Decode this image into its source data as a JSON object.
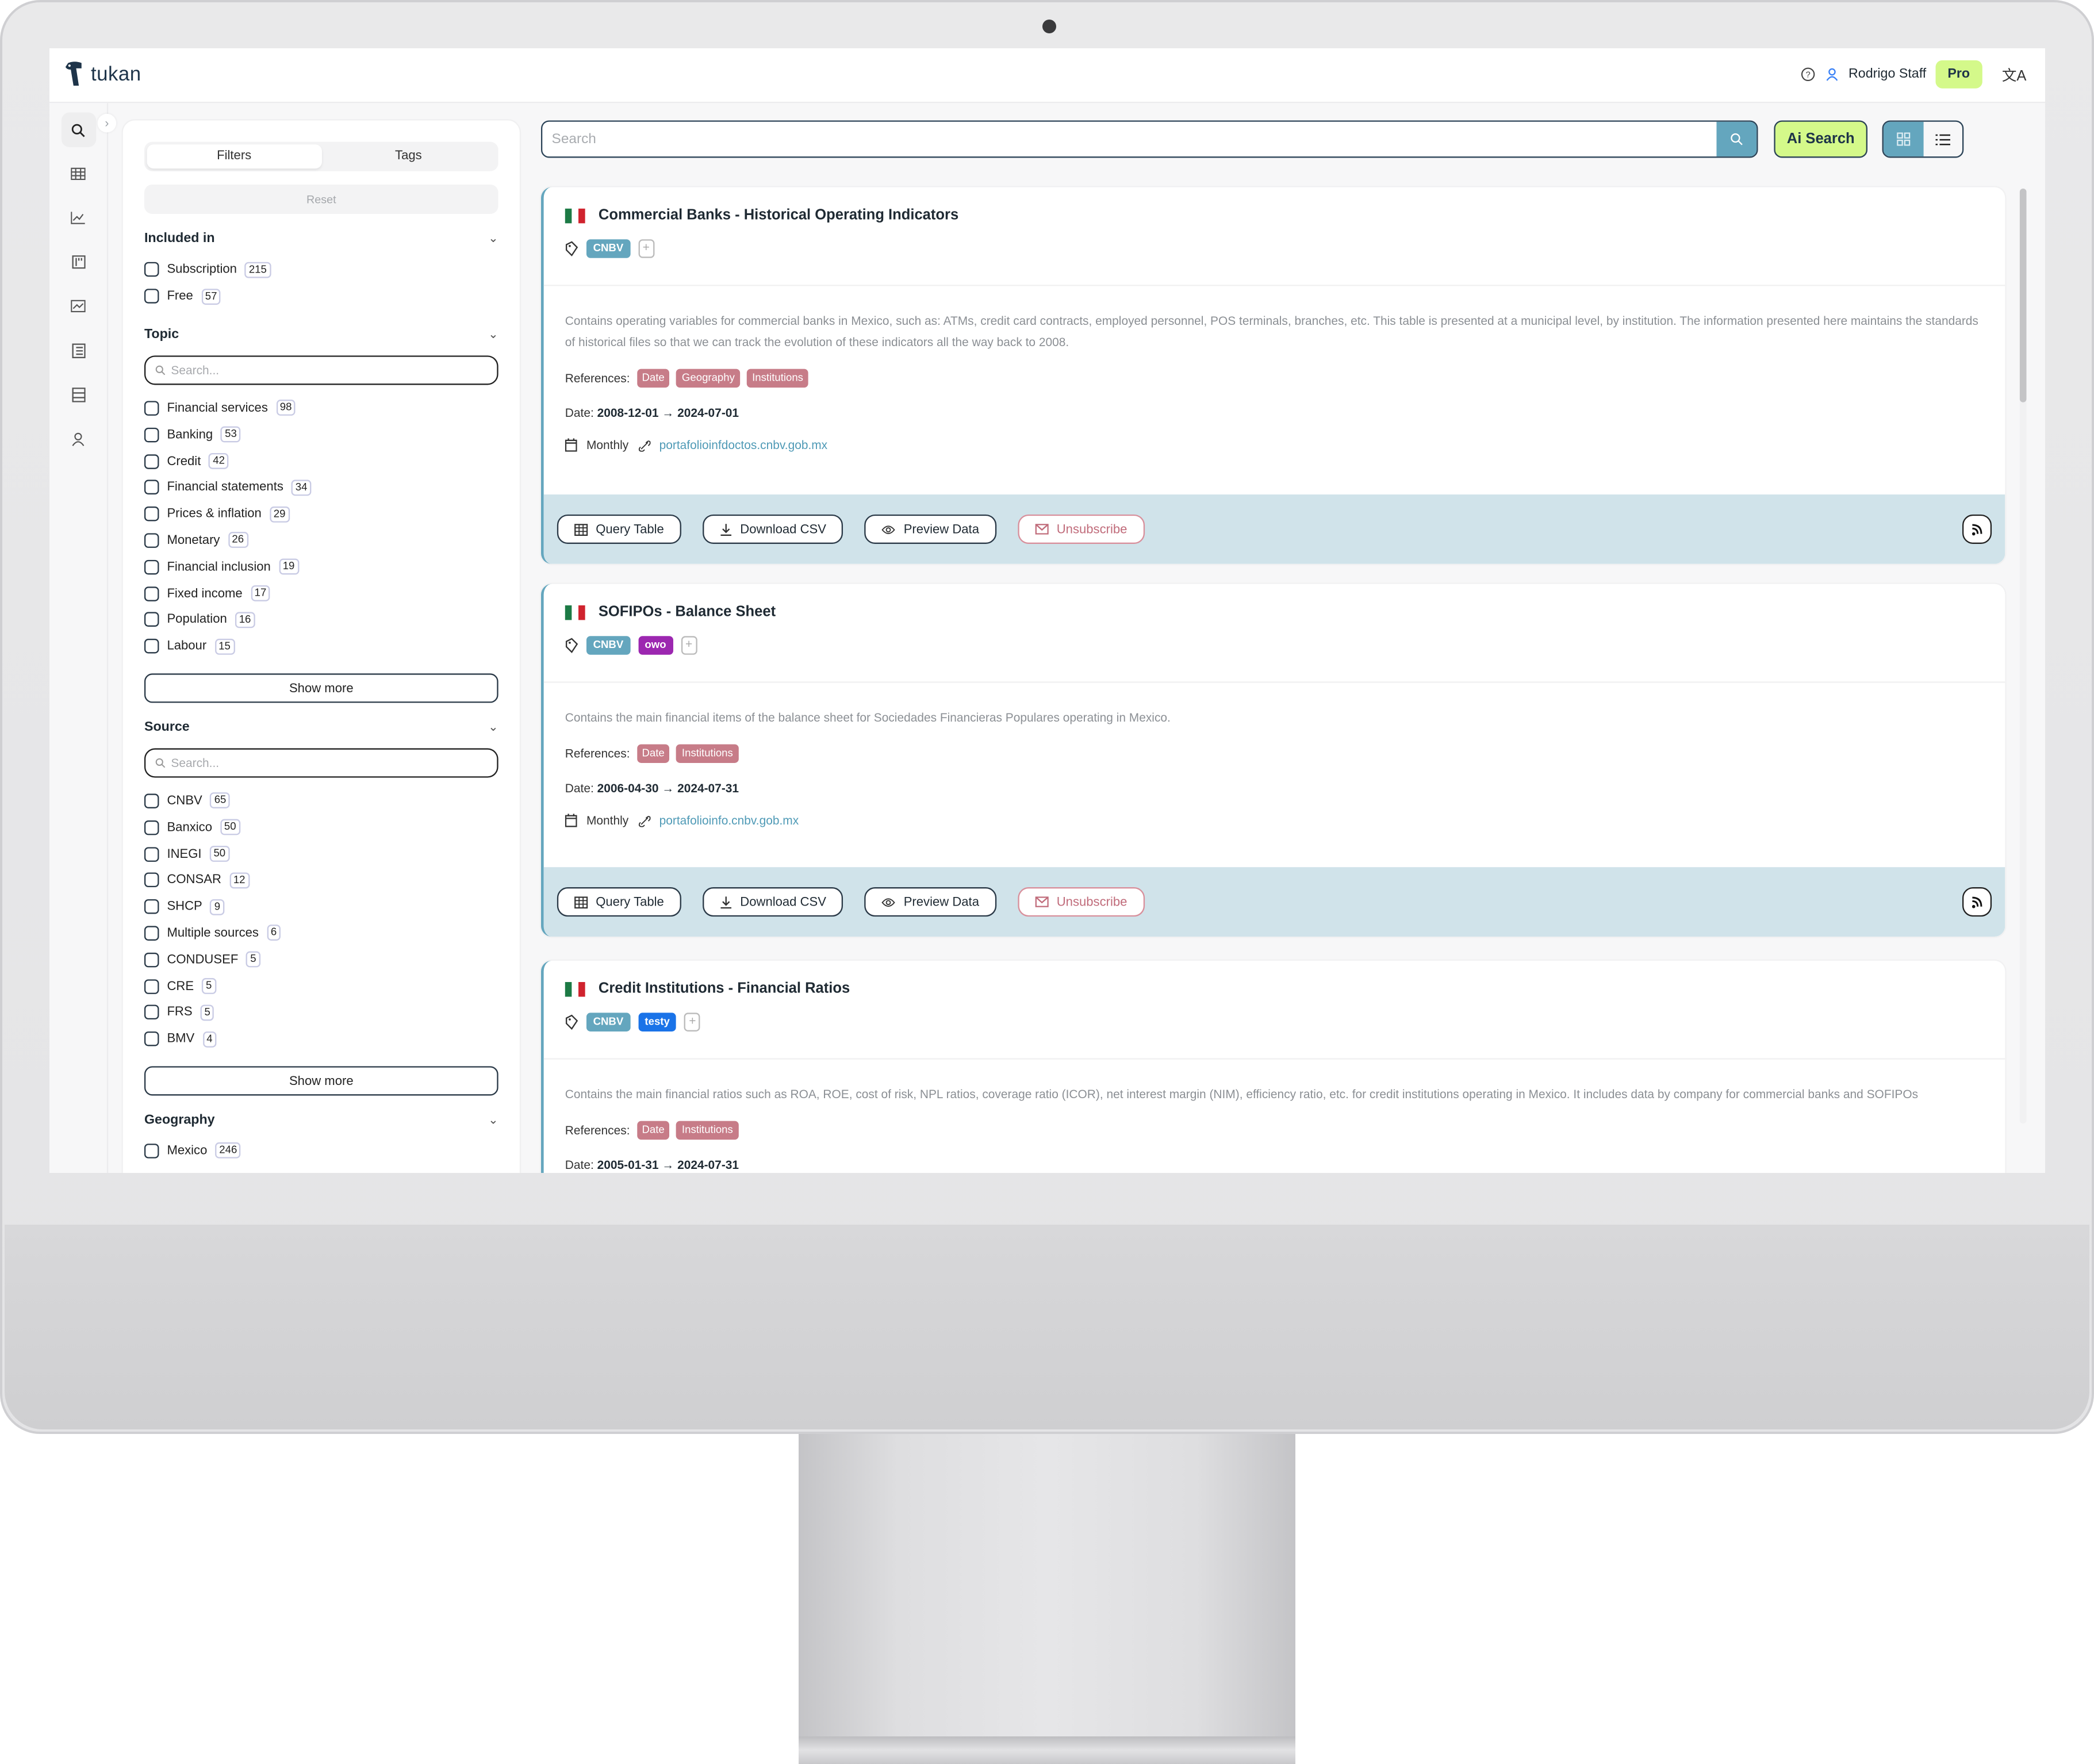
{
  "app": {
    "brand": "tukan",
    "user_name": "Rodrigo Staff",
    "plan_badge": "Pro",
    "icons": {
      "help": "help-circle-icon",
      "user": "user-icon",
      "language": "translate-icon"
    }
  },
  "rail": {
    "items": [
      {
        "icon": "search-icon",
        "active": true
      },
      {
        "icon": "table-icon"
      },
      {
        "icon": "line-chart-icon"
      },
      {
        "icon": "dashboard-icon"
      },
      {
        "icon": "trend-chart-icon"
      },
      {
        "icon": "list-icon"
      },
      {
        "icon": "database-icon"
      },
      {
        "icon": "user-icon"
      }
    ]
  },
  "filters": {
    "tabs": [
      {
        "label": "Filters",
        "active": true
      },
      {
        "label": "Tags",
        "active": false
      }
    ],
    "reset_label": "Reset",
    "show_more_label": "Show more",
    "search_placeholder": "Search...",
    "sections": {
      "included": {
        "title": "Included in",
        "options": [
          {
            "label": "Subscription",
            "count": "215"
          },
          {
            "label": "Free",
            "count": "57"
          }
        ]
      },
      "topic": {
        "title": "Topic",
        "options": [
          {
            "label": "Financial services",
            "count": "98"
          },
          {
            "label": "Banking",
            "count": "53"
          },
          {
            "label": "Credit",
            "count": "42"
          },
          {
            "label": "Financial statements",
            "count": "34"
          },
          {
            "label": "Prices & inflation",
            "count": "29"
          },
          {
            "label": "Monetary",
            "count": "26"
          },
          {
            "label": "Financial inclusion",
            "count": "19"
          },
          {
            "label": "Fixed income",
            "count": "17"
          },
          {
            "label": "Population",
            "count": "16"
          },
          {
            "label": "Labour",
            "count": "15"
          }
        ]
      },
      "source": {
        "title": "Source",
        "options": [
          {
            "label": "CNBV",
            "count": "65"
          },
          {
            "label": "Banxico",
            "count": "50"
          },
          {
            "label": "INEGI",
            "count": "50"
          },
          {
            "label": "CONSAR",
            "count": "12"
          },
          {
            "label": "SHCP",
            "count": "9"
          },
          {
            "label": "Multiple sources",
            "count": "6"
          },
          {
            "label": "CONDUSEF",
            "count": "5"
          },
          {
            "label": "CRE",
            "count": "5"
          },
          {
            "label": "FRS",
            "count": "5"
          },
          {
            "label": "BMV",
            "count": "4"
          }
        ]
      },
      "geography": {
        "title": "Geography",
        "options": [
          {
            "label": "Mexico",
            "count": "246"
          }
        ]
      }
    }
  },
  "search": {
    "placeholder": "Search",
    "value": "",
    "ai_label": "Ai Search",
    "view_modes": [
      {
        "icon": "grid-icon",
        "active": true
      },
      {
        "icon": "list-icon",
        "active": false
      }
    ]
  },
  "colors": {
    "accent": "#64a6be",
    "ai_button": "#d4f98a",
    "reference_tag": "#c77c88",
    "footer_band": "#d0e3ea",
    "tag_cnbv": "#64a6be",
    "tag_owo": "#9c27b0",
    "tag_testy": "#1a73e8"
  },
  "card_actions": {
    "query": "Query Table",
    "download": "Download CSV",
    "preview": "Preview Data",
    "unsubscribe": "Unsubscribe",
    "references_label": "References:",
    "date_label": "Date:"
  },
  "cards": [
    {
      "title": "Commercial Banks - Historical Operating Indicators",
      "tags": [
        {
          "label": "CNBV",
          "color": "#64a6be"
        }
      ],
      "description": "Contains operating variables for commercial banks in Mexico, such as: ATMs, credit card contracts, employed personnel, POS terminals, branches, etc. This table is presented at a municipal level, by institution. The information presented here maintains the standards of historical files so that we can track the evolution of these indicators all the way back to 2008.",
      "references": [
        "Date",
        "Geography",
        "Institutions"
      ],
      "date_range": "2008-12-01 → 2024-07-01",
      "frequency": "Monthly",
      "source_link": "portafolioinfdoctos.cnbv.gob.mx"
    },
    {
      "title": "SOFIPOs - Balance Sheet",
      "tags": [
        {
          "label": "CNBV",
          "color": "#64a6be"
        },
        {
          "label": "owo",
          "color": "#9c27b0"
        }
      ],
      "description": "Contains the main financial items of the balance sheet for Sociedades Financieras Populares operating in Mexico.",
      "references": [
        "Date",
        "Institutions"
      ],
      "date_range": "2006-04-30 → 2024-07-31",
      "frequency": "Monthly",
      "source_link": "portafolioinfo.cnbv.gob.mx"
    },
    {
      "title": "Credit Institutions - Financial Ratios",
      "tags": [
        {
          "label": "CNBV",
          "color": "#64a6be"
        },
        {
          "label": "testy",
          "color": "#1a73e8"
        }
      ],
      "description": "Contains the main financial ratios such as ROA, ROE, cost of risk, NPL ratios, coverage ratio (ICOR), net interest margin (NIM), efficiency ratio, etc. for credit institutions operating in Mexico. It includes data by company for commercial banks and SOFIPOs",
      "references": [
        "Date",
        "Institutions"
      ],
      "date_range": "2005-01-31 → 2024-07-31"
    }
  ]
}
